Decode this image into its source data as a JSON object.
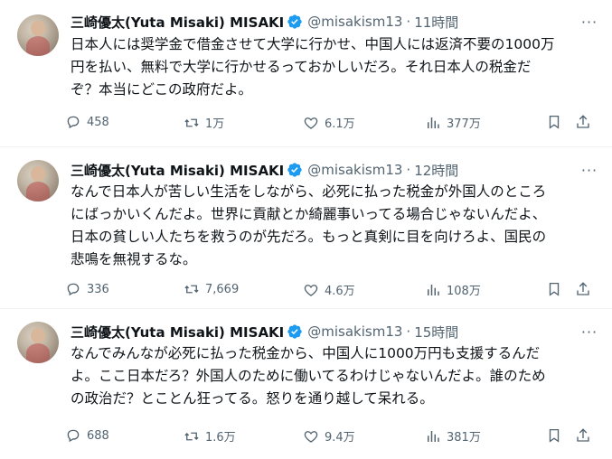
{
  "tweets": [
    {
      "name": "三崎優太(Yuta Misaki) MISAKI",
      "handle": "@misakism13",
      "sep": "·",
      "time": "11時間",
      "text": "日本人には奨学金で借金させて大学に行かせ、中国人には返済不要の1000万\n円を払い、無料で大学に行かせるっておかしいだろ。それ日本人の税金だ\nぞ？本当にどこの政府だよ。",
      "replies": "458",
      "retweets": "1万",
      "likes": "6.1万",
      "views": "377万"
    },
    {
      "name": "三崎優太(Yuta Misaki) MISAKI",
      "handle": "@misakism13",
      "sep": "·",
      "time": "12時間",
      "text": "なんで日本人が苦しい生活をしながら、必死に払った税金が外国人のところ\nにばっかいくんだよ。世界に貢献とか綺麗事いってる場合じゃないんだよ、\n日本の貧しい人たちを救うのが先だろ。もっと真剣に目を向けろよ、国民の\n悲鳴を無視するな。",
      "replies": "336",
      "retweets": "7,669",
      "likes": "4.6万",
      "views": "108万"
    },
    {
      "name": "三崎優太(Yuta Misaki) MISAKI",
      "handle": "@misakism13",
      "sep": "·",
      "time": "15時間",
      "text": "なんでみんなが必死に払った税金から、中国人に1000万円も支援するんだ\nよ。ここ日本だろ？外国人のために働いてるわけじゃないんだよ。誰のため\nの政治だ？とことん狂ってる。怒りを通り越して呆れる。",
      "replies": "688",
      "retweets": "1.6万",
      "likes": "9.4万",
      "views": "381万"
    }
  ],
  "icons": {
    "verified": "verified-badge-icon",
    "more": "more-options-icon",
    "reply": "reply-icon",
    "retweet": "retweet-icon",
    "like": "heart-icon",
    "views": "views-chart-icon",
    "bookmark": "bookmark-icon",
    "share": "share-icon"
  },
  "colors": {
    "verified": "#1d9bf0",
    "muted": "#536471",
    "text": "#0f1419",
    "divider": "#eff3f4"
  }
}
